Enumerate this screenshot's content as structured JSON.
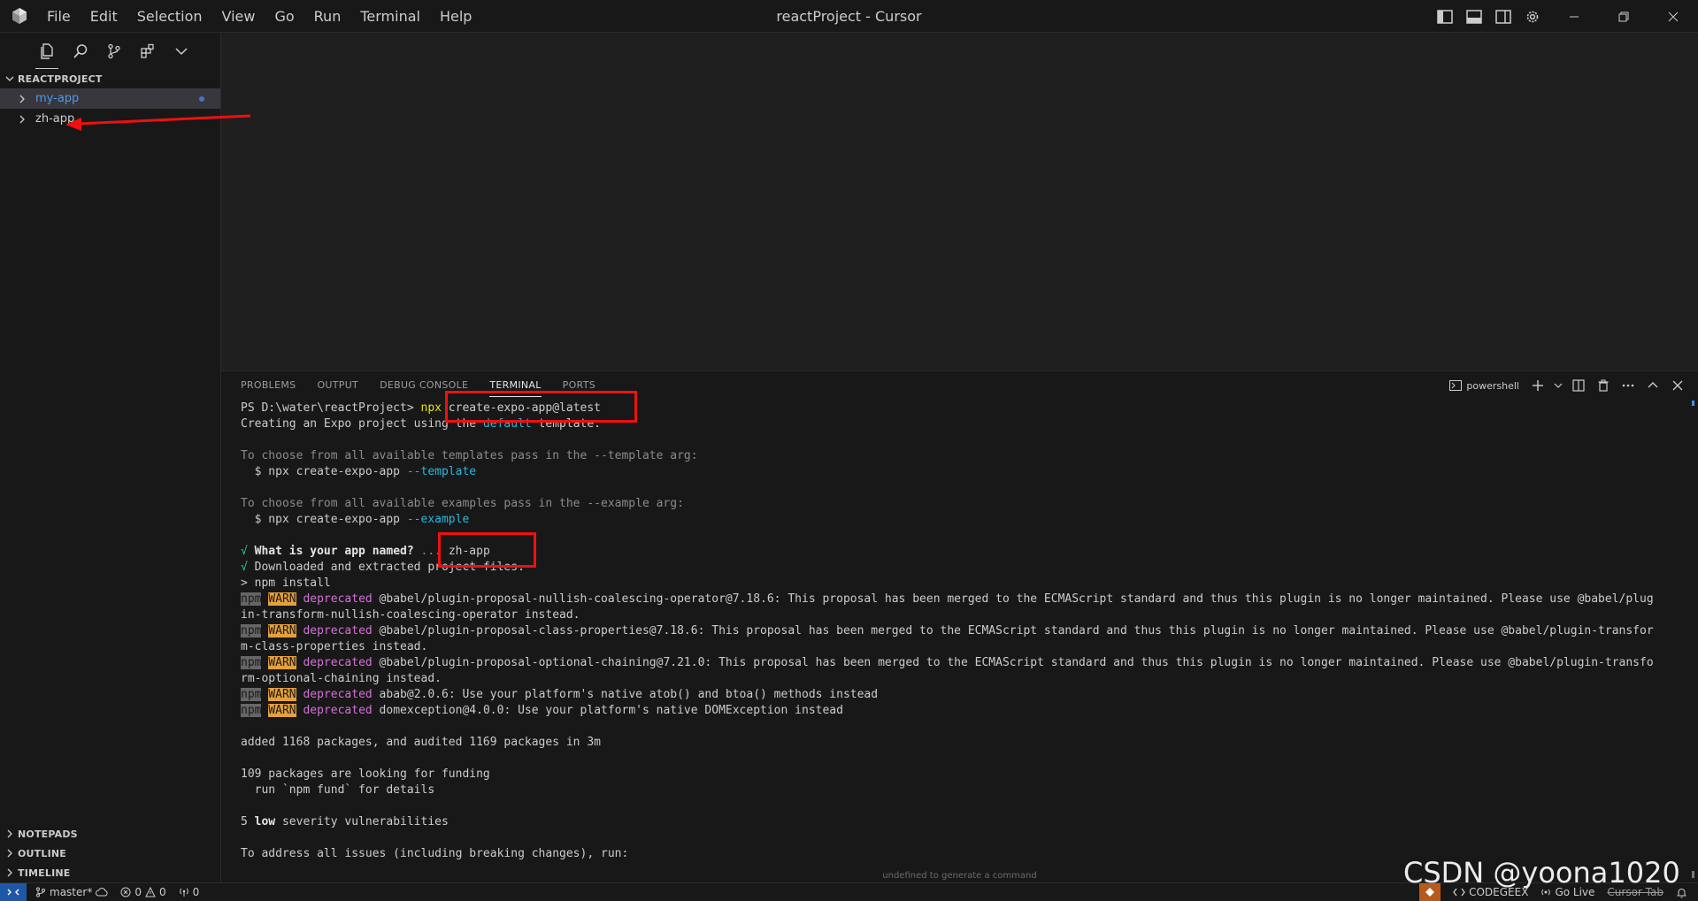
{
  "window": {
    "title": "reactProject - Cursor",
    "menu": [
      "File",
      "Edit",
      "Selection",
      "View",
      "Go",
      "Run",
      "Terminal",
      "Help"
    ]
  },
  "sidebar": {
    "explorer_title": "REACTPROJECT",
    "items": [
      {
        "label": "my-app",
        "selected": true,
        "modified": true
      },
      {
        "label": "zh-app",
        "selected": false,
        "modified": false
      }
    ],
    "bottom_sections": [
      "NOTEPADS",
      "OUTLINE",
      "TIMELINE"
    ]
  },
  "panel": {
    "tabs": [
      "PROBLEMS",
      "OUTPUT",
      "DEBUG CONSOLE",
      "TERMINAL",
      "PORTS"
    ],
    "active_tab": "TERMINAL",
    "shell": "powershell",
    "hint": "undefined to generate a command"
  },
  "terminal": {
    "prompt": "PS D:\\water\\reactProject>",
    "command_npx": "npx",
    "command_rest": " create-expo-app@latest",
    "l_creating_a": "Creating an Expo project using the ",
    "l_creating_b": "default",
    "l_creating_c": " template.",
    "l_choose_templates": "To choose from all available templates pass in the --template arg:",
    "l_template_cmd": "  $ npx create-expo-app ",
    "l_template_flag": "--template",
    "l_choose_examples": "To choose from all available examples pass in the --example arg:",
    "l_example_cmd": "  $ npx create-expo-app ",
    "l_example_flag": "--example",
    "check": "√",
    "l_appname_q": "What is your app named?",
    "l_appname_dots": " ... ",
    "l_appname_a": "zh-app",
    "l_downloaded": " Downloaded and extracted project files.",
    "l_npm_install": "> npm install",
    "npm": "npm",
    "warn": "WARN",
    "deprecated": "deprecated",
    "w1a": " @babel/plugin-proposal-nullish-coalescing-operator@7.18.6: This proposal has been merged to the ECMAScript standard and thus this plugin is no longer maintained. Please use @babel/plug",
    "w1b": "in-transform-nullish-coalescing-operator instead.",
    "w2a": " @babel/plugin-proposal-class-properties@7.18.6: This proposal has been merged to the ECMAScript standard and thus this plugin is no longer maintained. Please use @babel/plugin-transfor",
    "w2b": "m-class-properties instead.",
    "w3a": " @babel/plugin-proposal-optional-chaining@7.21.0: This proposal has been merged to the ECMAScript standard and thus this plugin is no longer maintained. Please use @babel/plugin-transfo",
    "w3b": "rm-optional-chaining instead.",
    "w4": " abab@2.0.6: Use your platform's native atob() and btoa() methods instead",
    "w5": " domexception@4.0.0: Use your platform's native DOMException instead",
    "l_added": "added 1168 packages, and audited 1169 packages in 3m",
    "l_funding": "109 packages are looking for funding",
    "l_fund_cmd": "  run `npm fund` for details",
    "l_vuln_count": "5 ",
    "l_vuln_low": "low",
    "l_vuln_rest": " severity vulnerabilities",
    "l_address": "To address all issues (including breaking changes), run:"
  },
  "statusbar": {
    "branch": "master*",
    "errors": "0",
    "warnings": "0",
    "ports": "0",
    "codegeex": "CODEGEEX",
    "golive": "Go Live",
    "cursor_tab": "Cursor Tab"
  },
  "watermark": "CSDN @yoona1020",
  "colors": {
    "accent": "#3794ff",
    "annotation_red": "#ef1010",
    "selection": "#37373d"
  }
}
